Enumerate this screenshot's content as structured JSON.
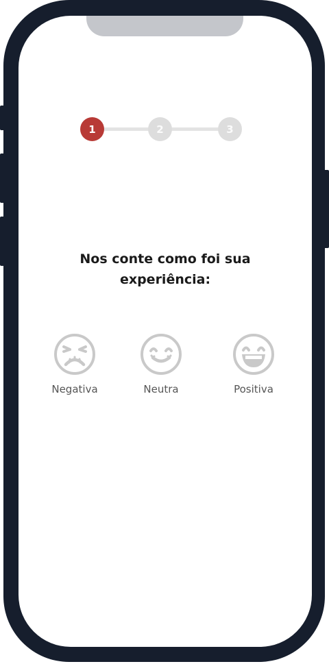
{
  "stepper": {
    "steps": [
      {
        "label": "1",
        "state": "active"
      },
      {
        "label": "2",
        "state": "inactive"
      },
      {
        "label": "3",
        "state": "inactive"
      }
    ],
    "active_color": "#b83a36",
    "inactive_color": "#dddddd"
  },
  "question": {
    "line1": "Nos conte como foi sua",
    "line2": "experiência:"
  },
  "options": [
    {
      "label": "Negativa",
      "icon": "angry-face-icon"
    },
    {
      "label": "Neutra",
      "icon": "smiling-face-icon"
    },
    {
      "label": "Positiva",
      "icon": "grinning-face-icon"
    }
  ],
  "colors": {
    "frame": "#161e2d",
    "notch": "#c4c6cb",
    "icon_gray": "#c9c9c9"
  }
}
